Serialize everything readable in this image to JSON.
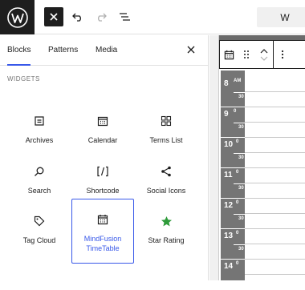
{
  "toolbar": {
    "undo_icon": "undo-icon",
    "redo_icon": "redo-icon",
    "list_view_icon": "list-view-icon",
    "doc_title": "W"
  },
  "sidebar": {
    "tabs": [
      {
        "label": "Blocks",
        "active": true
      },
      {
        "label": "Patterns",
        "active": false
      },
      {
        "label": "Media",
        "active": false
      }
    ],
    "section_title": "WIDGETS",
    "blocks": [
      {
        "label": "Archives",
        "icon": "archive-icon"
      },
      {
        "label": "Calendar",
        "icon": "calendar-icon"
      },
      {
        "label": "Terms List",
        "icon": "categories-icon"
      },
      {
        "label": "Search",
        "icon": "search-icon"
      },
      {
        "label": "Shortcode",
        "icon": "shortcode-icon"
      },
      {
        "label": "Social Icons",
        "icon": "share-icon"
      },
      {
        "label": "Tag Cloud",
        "icon": "tag-icon"
      },
      {
        "label": "MindFusion TimeTable",
        "icon": "timetable-icon",
        "selected": true
      },
      {
        "label": "Star Rating",
        "icon": "star-icon"
      }
    ]
  },
  "timetable": {
    "hours": [
      {
        "hour": "8",
        "minute": "AM",
        "half": "30"
      },
      {
        "hour": "9",
        "minute": "0",
        "half": "30"
      },
      {
        "hour": "10",
        "minute": "0",
        "half": "30"
      },
      {
        "hour": "11",
        "minute": "0",
        "half": "30"
      },
      {
        "hour": "12",
        "minute": "0",
        "half": "30"
      },
      {
        "hour": "13",
        "minute": "0",
        "half": "30"
      },
      {
        "hour": "14",
        "minute": "0",
        "half": ""
      }
    ]
  },
  "colors": {
    "accent": "#3858e9",
    "dark": "#1e1e1e",
    "star_green": "#2e9b3a",
    "hour_column": "#757575"
  }
}
